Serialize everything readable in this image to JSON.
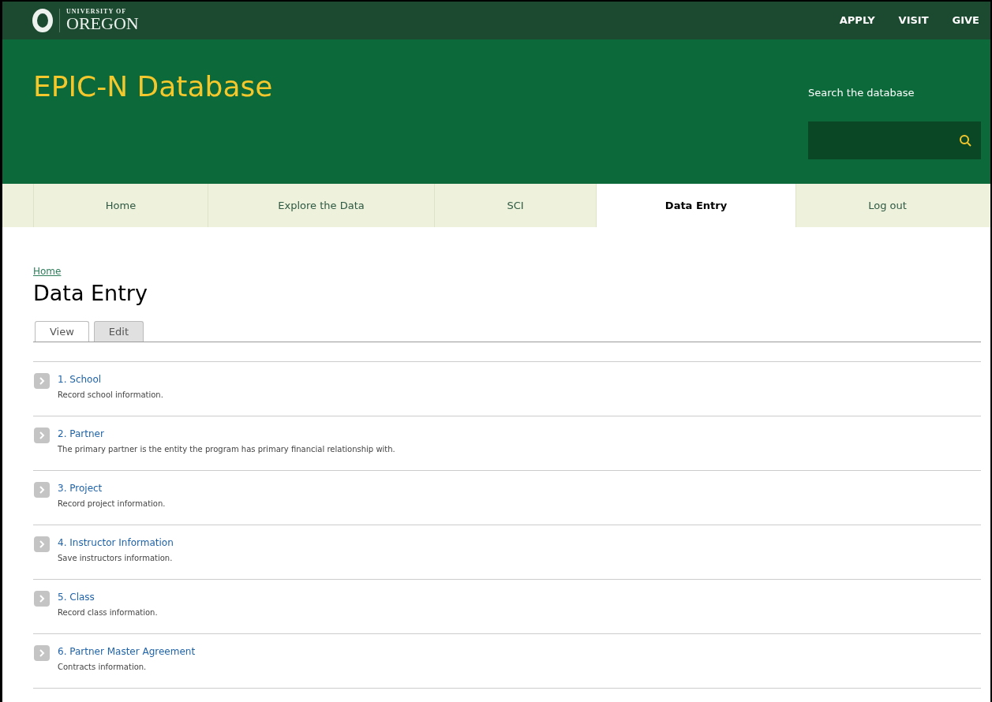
{
  "top_bar": {
    "logo": {
      "line_1": "UNIVERSITY OF",
      "line_2": "OREGON"
    },
    "links": [
      "APPLY",
      "VISIT",
      "GIVE"
    ]
  },
  "header": {
    "site_title": "EPIC-N Database",
    "search": {
      "label": "Search the database"
    }
  },
  "nav": [
    {
      "label": "Home",
      "selected": false
    },
    {
      "label": "Explore the Data",
      "selected": false
    },
    {
      "label": "SCI",
      "selected": false
    },
    {
      "label": "Data Entry",
      "selected": true
    },
    {
      "label": "Log out",
      "selected": false
    }
  ],
  "breadcrumb": "Home",
  "page_title": "Data Entry",
  "tabs": [
    {
      "label": "View",
      "selected": true
    },
    {
      "label": "Edit",
      "selected": false
    }
  ],
  "items": [
    {
      "title": "1. School",
      "description": "Record school information."
    },
    {
      "title": "2. Partner",
      "description": "The primary partner is the entity the program has primary financial relationship with."
    },
    {
      "title": "3. Project",
      "description": "Record project information."
    },
    {
      "title": "4. Instructor Information",
      "description": "Save instructors information."
    },
    {
      "title": "5. Class",
      "description": "Record class information."
    },
    {
      "title": "6. Partner Master Agreement",
      "description": "Contracts information."
    }
  ]
}
